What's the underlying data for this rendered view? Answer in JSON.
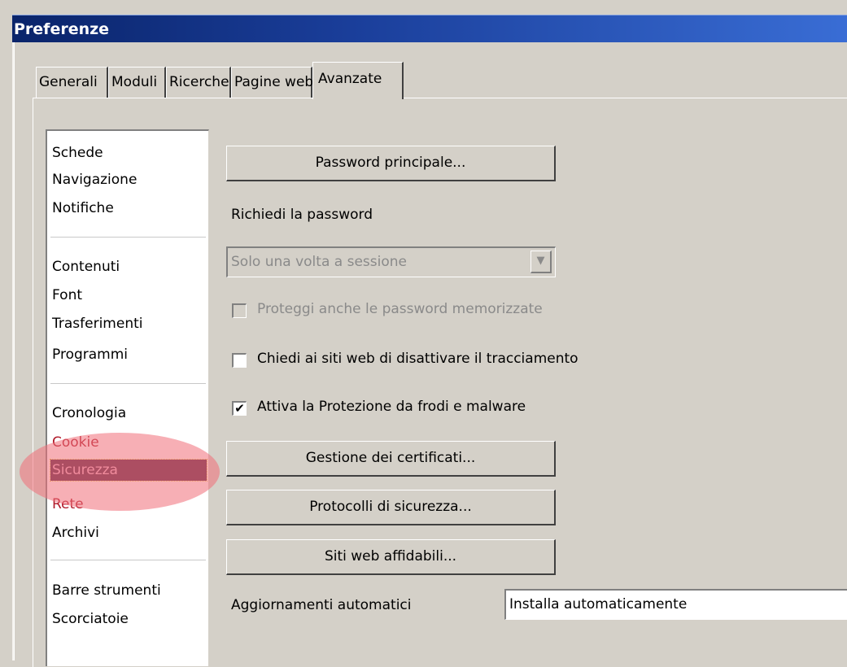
{
  "window": {
    "title": "Preferenze"
  },
  "tabs": [
    {
      "label": "Generali"
    },
    {
      "label": "Moduli"
    },
    {
      "label": "Ricerche"
    },
    {
      "label": "Pagine web"
    },
    {
      "label": "Avanzate",
      "active": true
    }
  ],
  "sidebar": {
    "groups": [
      {
        "items": [
          "Schede",
          "Navigazione",
          "Notifiche"
        ]
      },
      {
        "items": [
          "Contenuti",
          "Font",
          "Trasferimenti",
          "Programmi"
        ]
      },
      {
        "items": [
          "Cronologia",
          "Cookie",
          "Sicurezza",
          "Rete",
          "Archivi"
        ]
      },
      {
        "items": [
          "Barre strumenti",
          "Scorciatoie"
        ]
      }
    ],
    "selected": "Sicurezza"
  },
  "security": {
    "master_password_button": "Password principale...",
    "ask_password_label": "Richiedi la password",
    "ask_password_select": "Solo una volta a sessione",
    "protect_saved_label": "Proteggi anche le password memorizzate",
    "protect_saved_checked": false,
    "do_not_track_label": "Chiedi ai siti web di disattivare il tracciamento",
    "do_not_track_checked": false,
    "fraud_protection_label": "Attiva la Protezione da frodi e malware",
    "fraud_protection_checked": true,
    "certificates_button": "Gestione dei certificati...",
    "protocols_button": "Protocolli di sicurezza...",
    "trusted_sites_button": "Siti web affidabili...",
    "auto_updates_label": "Aggiornamenti automatici",
    "auto_updates_select": "Installa automaticamente"
  },
  "icons": {
    "check": "✔",
    "dropdown_arrow": "▼"
  },
  "colors": {
    "titlebar": "#0a246a",
    "selected_item_bg": "#5a2848",
    "highlight_oval": "#f06e78",
    "red_text": "#b01a2a"
  }
}
